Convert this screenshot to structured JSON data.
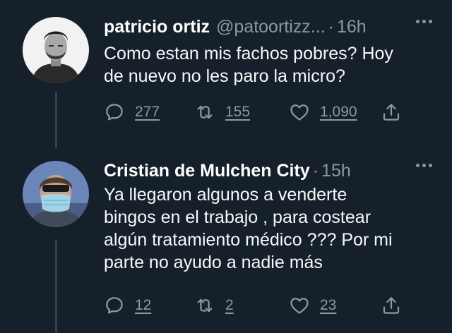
{
  "colors": {
    "background": "#15202b",
    "text_primary": "#ffffff",
    "text_secondary": "#8b98a5",
    "thread_line": "#38444d"
  },
  "tweets": [
    {
      "name": "patricio ortiz",
      "handle": "@patoortizz...",
      "separator": "·",
      "time": "16h",
      "text_lines": [
        "Como estan mis fachos pobres? Hoy",
        "de nuevo no les paro la micro?"
      ],
      "replies": "277",
      "retweets": "155",
      "likes": "1,090",
      "avatar_icon": "person-avatar-icon"
    },
    {
      "name": "Cristian de Mulchen City",
      "separator": "·",
      "time": "15h",
      "text_lines": [
        "Ya llegaron algunos a venderte",
        "bingos en el trabajo , para costear",
        "algún tratamiento médico ??? Por mi",
        "parte no ayudo a nadie más"
      ],
      "replies": "12",
      "retweets": "2",
      "likes": "23",
      "avatar_icon": "masked-person-avatar-icon"
    }
  ]
}
